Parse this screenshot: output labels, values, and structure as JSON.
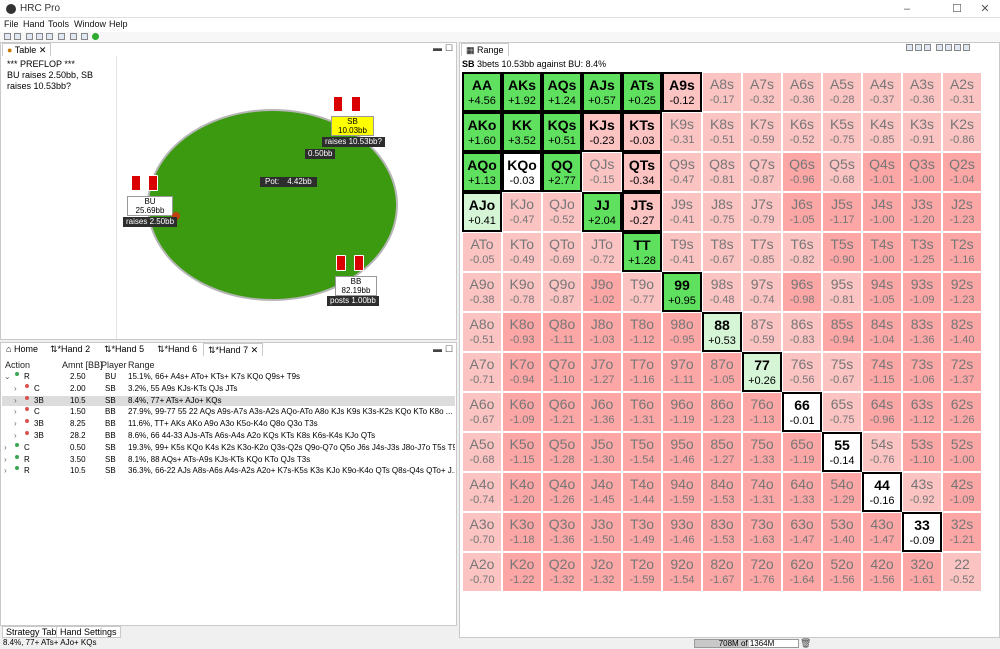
{
  "window": {
    "title": "HRC Pro",
    "controls": [
      "–",
      "☐",
      "✕"
    ]
  },
  "menu": [
    "File",
    "Hand",
    "Tools",
    "Window",
    "Help"
  ],
  "table_pane": {
    "tab_label": "Table",
    "text": "*** PREFLOP ***\nBU raises 2.50bb, SB raises 10.53bb?",
    "pot_label": "Pot:",
    "pot_value": "4.42bb",
    "players": {
      "sb": {
        "name": "SB",
        "stack": "10.03bb",
        "action": "raises 10.53bb?",
        "bet": "0.50bb"
      },
      "bu": {
        "name": "BU",
        "stack": "25.69bb",
        "action": "raises 2.50bb"
      },
      "bb": {
        "name": "BB",
        "stack": "82.19bb",
        "action": "posts 1.00bb"
      }
    }
  },
  "hand_tabs": [
    "Home",
    "*Hand 2",
    "*Hand 5",
    "*Hand 6",
    "*Hand 7"
  ],
  "action_panel": {
    "columns": [
      "Action",
      "Amnt [BB]",
      "Player",
      "Range"
    ],
    "rows": [
      {
        "action": "R",
        "amount": "2.50",
        "player": "BU",
        "range": "15.1%, 66+ A4s+ ATo+ KTs+ K7s KQo Q9s+ T9s",
        "dot": "#3aa655",
        "indent": 0,
        "expander": "⌄"
      },
      {
        "action": "C",
        "amount": "2.00",
        "player": "SB",
        "range": "3.2%, 55 A9s KJs-KTs QJs JTs",
        "dot": "#d9534f",
        "indent": 1,
        "expander": "›"
      },
      {
        "action": "3B",
        "amount": "10.5",
        "player": "SB",
        "range": "8.4%, 77+ ATs+ AJo+ KQs",
        "dot": "#d9534f",
        "indent": 1,
        "expander": "›",
        "selected": true
      },
      {
        "action": "C",
        "amount": "1.50",
        "player": "BB",
        "range": "27.9%, 99-77 55 22 AQs A9s-A7s A3s-A2s AQo-ATo A8o KJs K9s K3s-K2s KQo KTo K8o ...",
        "dot": "#d9534f",
        "indent": 1,
        "expander": "›"
      },
      {
        "action": "3B",
        "amount": "8.25",
        "player": "BB",
        "range": "11.6%, TT+ AKs AKo A9o A3o K5o-K4o Q8o Q3o T3s",
        "dot": "#d9534f",
        "indent": 1,
        "expander": "›"
      },
      {
        "action": "3B",
        "amount": "28.2",
        "player": "BB",
        "range": "8.6%, 66 44-33 AJs-ATs A6s-A4s A2o KQs KTs K8s K6s-K4s KJo QTs",
        "dot": "#d9534f",
        "indent": 1,
        "expander": "›"
      },
      {
        "action": "C",
        "amount": "0.50",
        "player": "SB",
        "range": "19.3%, 99+ K5s KQo K4s K2s K3o-K2o Q3s-Q2s Q9o-Q7o Q5o J6s J4s-J3s J8o-J7o T5s T9...",
        "dot": "#3aa655",
        "indent": 0,
        "expander": "›"
      },
      {
        "action": "R",
        "amount": "3.50",
        "player": "SB",
        "range": "8.1%, 88 AQs+ ATs-A9s KJs-KTs KQo KTo QJs T3s",
        "dot": "#3aa655",
        "indent": 0,
        "expander": "›"
      },
      {
        "action": "R",
        "amount": "10.5",
        "player": "SB",
        "range": "36.3%, 66-22 AJs A8s-A6s A4s-A2s A2o+ K7s-K5s K3s KJo K9o-K4o QTs Q8s-Q4s QTo+ J...",
        "dot": "#3aa655",
        "indent": 0,
        "expander": "›"
      }
    ]
  },
  "range_pane": {
    "tab_label": "Range",
    "header_bold": "SB",
    "header_text": "3bets 10.53bb against BU: 8.4%",
    "grid": [
      [
        "AA|+4.56|gr|b",
        "AKs|+1.92|gr|b",
        "AQs|+1.24|gr|b",
        "AJs|+0.57|gr|b",
        "ATs|+0.25|gr|b",
        "A9s|-0.12|pr|b",
        "A8s|-0.17|pr",
        "A7s|-0.32|pr",
        "A6s|-0.36|pr",
        "A5s|-0.28|pr",
        "A4s|-0.37|pr",
        "A3s|-0.36|pr",
        "A2s|-0.31|pr"
      ],
      [
        "AKo|+1.60|gr|b",
        "KK|+3.52|gr|b",
        "KQs|+0.51|gr|b",
        "KJs|-0.23|pr|b",
        "KTs|-0.03|pr|b",
        "K9s|-0.31|pr",
        "K8s|-0.51|pr",
        "K7s|-0.59|pr",
        "K6s|-0.52|pr",
        "K5s|-0.75|pr",
        "K4s|-0.85|pr",
        "K3s|-0.91|pr",
        "K2s|-0.86|pr"
      ],
      [
        "AQo|+1.13|gr|b",
        "KQo|-0.03|wh|b",
        "QQ|+2.77|gr|b",
        "QJs|-0.15|pr",
        "QTs|-0.34|pr|b",
        "Q9s|-0.47|pr",
        "Q8s|-0.81|pr",
        "Q7s|-0.87|pr",
        "Q6s|-0.96|pk",
        "Q5s|-0.68|pr",
        "Q4s|-1.01|pk",
        "Q3s|-1.00|pk",
        "Q2s|-1.04|pk"
      ],
      [
        "AJo|+0.41|lg|b",
        "KJo|-0.47|pr",
        "QJo|-0.52|pr",
        "JJ|+2.04|gr|b",
        "JTs|-0.27|pr|b",
        "J9s|-0.41|pr",
        "J8s|-0.75|pr",
        "J7s|-0.79|pr",
        "J6s|-1.05|pk",
        "J5s|-1.17|pk",
        "J4s|-1.00|pk",
        "J3s|-1.20|pk",
        "J2s|-1.23|pk"
      ],
      [
        "ATo|-0.05|pr",
        "KTo|-0.49|pr",
        "QTo|-0.69|pr",
        "JTo|-0.72|pr",
        "TT|+1.28|gr|b",
        "T9s|-0.41|pr",
        "T8s|-0.67|pr",
        "T7s|-0.85|pr",
        "T6s|-0.82|pr",
        "T5s|-0.90|pk",
        "T4s|-1.00|pk",
        "T3s|-1.25|pk",
        "T2s|-1.16|pk"
      ],
      [
        "A9o|-0.38|pr",
        "K9o|-0.78|pr",
        "Q9o|-0.87|pr",
        "J9o|-1.02|pk",
        "T9o|-0.77|pr",
        "99|+0.95|gr|b",
        "98s|-0.48|pr",
        "97s|-0.74|pr",
        "96s|-0.98|pk",
        "95s|-0.81|pr",
        "94s|-1.05|pk",
        "93s|-1.09|pk",
        "92s|-1.23|pk"
      ],
      [
        "A8o|-0.51|pr",
        "K8o|-0.93|pk",
        "Q8o|-1.11|pk",
        "J8o|-1.03|pk",
        "T8o|-1.12|pk",
        "98o|-0.95|pk",
        "88|+0.53|lg|b",
        "87s|-0.59|pr",
        "86s|-0.83|pr",
        "85s|-0.94|pk",
        "84s|-1.04|pk",
        "83s|-1.36|pk",
        "82s|-1.40|pk"
      ],
      [
        "A7o|-0.71|pr",
        "K7o|-0.94|pk",
        "Q7o|-1.10|pk",
        "J7o|-1.27|pk",
        "T7o|-1.16|pk",
        "97o|-1.11|pk",
        "87o|-1.05|pk",
        "77|+0.26|lg|b",
        "76s|-0.56|pr",
        "75s|-0.67|pr",
        "74s|-1.15|pk",
        "73s|-1.06|pk",
        "72s|-1.37|pk"
      ],
      [
        "A6o|-0.67|pr",
        "K6o|-1.09|pk",
        "Q6o|-1.21|pk",
        "J6o|-1.36|pk",
        "T6o|-1.31|pk",
        "96o|-1.19|pk",
        "86o|-1.23|pk",
        "76o|-1.13|pk",
        "66|-0.01|wh|b",
        "65s|-0.75|pr",
        "64s|-0.96|pk",
        "63s|-1.12|pk",
        "62s|-1.26|pk"
      ],
      [
        "A5o|-0.68|pr",
        "K5o|-1.15|pk",
        "Q5o|-1.28|pk",
        "J5o|-1.30|pk",
        "T5o|-1.54|pk",
        "95o|-1.46|pk",
        "85o|-1.27|pk",
        "75o|-1.33|pk",
        "65o|-1.19|pk",
        "55|-0.14|wh|b",
        "54s|-0.76|pr",
        "53s|-1.10|pk",
        "52s|-1.00|pk"
      ],
      [
        "A4o|-0.74|pr",
        "K4o|-1.20|pk",
        "Q4o|-1.26|pk",
        "J4o|-1.45|pk",
        "T4o|-1.44|pk",
        "94o|-1.59|pk",
        "84o|-1.53|pk",
        "74o|-1.31|pk",
        "64o|-1.33|pk",
        "54o|-1.29|pk",
        "44|-0.16|wh|b",
        "43s|-0.92|pr",
        "42s|-1.09|pk"
      ],
      [
        "A3o|-0.70|pr",
        "K3o|-1.18|pk",
        "Q3o|-1.36|pk",
        "J3o|-1.50|pk",
        "T3o|-1.49|pk",
        "93o|-1.46|pk",
        "83o|-1.53|pk",
        "73o|-1.63|pk",
        "63o|-1.47|pk",
        "53o|-1.40|pk",
        "43o|-1.47|pk",
        "33|-0.09|wh|b",
        "32s|-1.21|pk"
      ],
      [
        "A2o|-0.70|pr",
        "K2o|-1.22|pk",
        "Q2o|-1.32|pk",
        "J2o|-1.32|pk",
        "T2o|-1.59|pk",
        "92o|-1.54|pk",
        "82o|-1.67|pk",
        "72o|-1.76|pk",
        "62o|-1.64|pk",
        "52o|-1.56|pk",
        "42o|-1.56|pk",
        "32o|-1.61|pk",
        "22|-0.52|pr"
      ]
    ]
  },
  "bottom_tabs": [
    "Strategy Table",
    "Hand Settings"
  ],
  "status": {
    "text": "8.4%, 77+ ATs+ AJo+ KQs",
    "memory": "708M of 1364M",
    "memory_fraction": 0.52
  }
}
